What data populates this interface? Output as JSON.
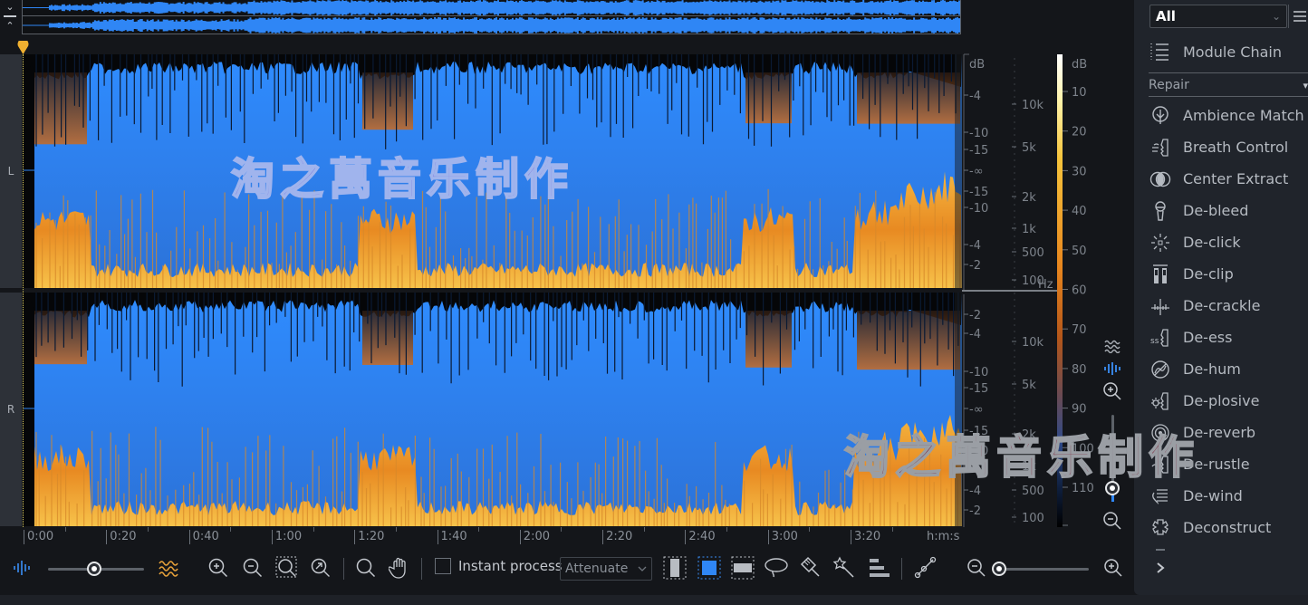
{
  "overview": {
    "collapse_up_label": "⌄",
    "collapse_down_label": "⌃"
  },
  "channels": [
    {
      "label": "L"
    },
    {
      "label": "R"
    }
  ],
  "amplitude_scale": {
    "unit": "dB",
    "left_ticks": [
      "-4",
      "-10",
      "-15",
      "-∞",
      "-15",
      "-10",
      "-4",
      "-2"
    ],
    "right_ticks": [
      "-2",
      "-4",
      "-10",
      "-15",
      "-∞",
      "-15",
      "-10",
      "-4",
      "-2"
    ]
  },
  "frequency_scale": {
    "unit": "Hz",
    "ticks": [
      "10k",
      "5k",
      "2k",
      "1k",
      "500",
      "100"
    ]
  },
  "color_scale": {
    "unit": "dB",
    "ticks": [
      "10",
      "20",
      "30",
      "40",
      "50",
      "60",
      "70",
      "80",
      "90",
      "100",
      "110"
    ]
  },
  "timeline": {
    "ticks": [
      "0:00",
      "0:20",
      "0:40",
      "1:00",
      "1:20",
      "1:40",
      "2:00",
      "2:20",
      "2:40",
      "3:00",
      "3:20"
    ],
    "format_label": "h:m:s"
  },
  "toolbar": {
    "waveform_spectrogram_blend": 0.5,
    "instant_process_label": "Instant process",
    "instant_process_checked": false,
    "attenuate_value": "Attenuate",
    "horizontal_zoom": 0.0
  },
  "vertical_zoom": {
    "level": 0.85
  },
  "right_panel": {
    "filter_value": "All",
    "module_chain_label": "Module Chain",
    "category_value": "Repair",
    "modules": [
      {
        "label": "Ambience Match",
        "icon": "ambience-match-icon"
      },
      {
        "label": "Breath Control",
        "icon": "breath-control-icon"
      },
      {
        "label": "Center Extract",
        "icon": "center-extract-icon"
      },
      {
        "label": "De-bleed",
        "icon": "microphone-icon"
      },
      {
        "label": "De-click",
        "icon": "de-click-icon"
      },
      {
        "label": "De-clip",
        "icon": "de-clip-icon"
      },
      {
        "label": "De-crackle",
        "icon": "de-crackle-icon"
      },
      {
        "label": "De-ess",
        "icon": "de-ess-icon"
      },
      {
        "label": "De-hum",
        "icon": "de-hum-icon"
      },
      {
        "label": "De-plosive",
        "icon": "de-plosive-icon"
      },
      {
        "label": "De-reverb",
        "icon": "de-reverb-icon"
      },
      {
        "label": "De-rustle",
        "icon": "de-rustle-icon"
      },
      {
        "label": "De-wind",
        "icon": "de-wind-icon"
      },
      {
        "label": "Deconstruct",
        "icon": "deconstruct-icon"
      }
    ]
  },
  "watermarks": [
    "淘之萬音乐制作",
    "淘之萬音乐制作"
  ],
  "colors": {
    "accent_blue": "#2f86f5",
    "spectrum_orange": "#e8902a",
    "marker_yellow": "#f0b030",
    "watermark_red": "#7a1830",
    "watermark_purple": "#7b6fd6"
  }
}
